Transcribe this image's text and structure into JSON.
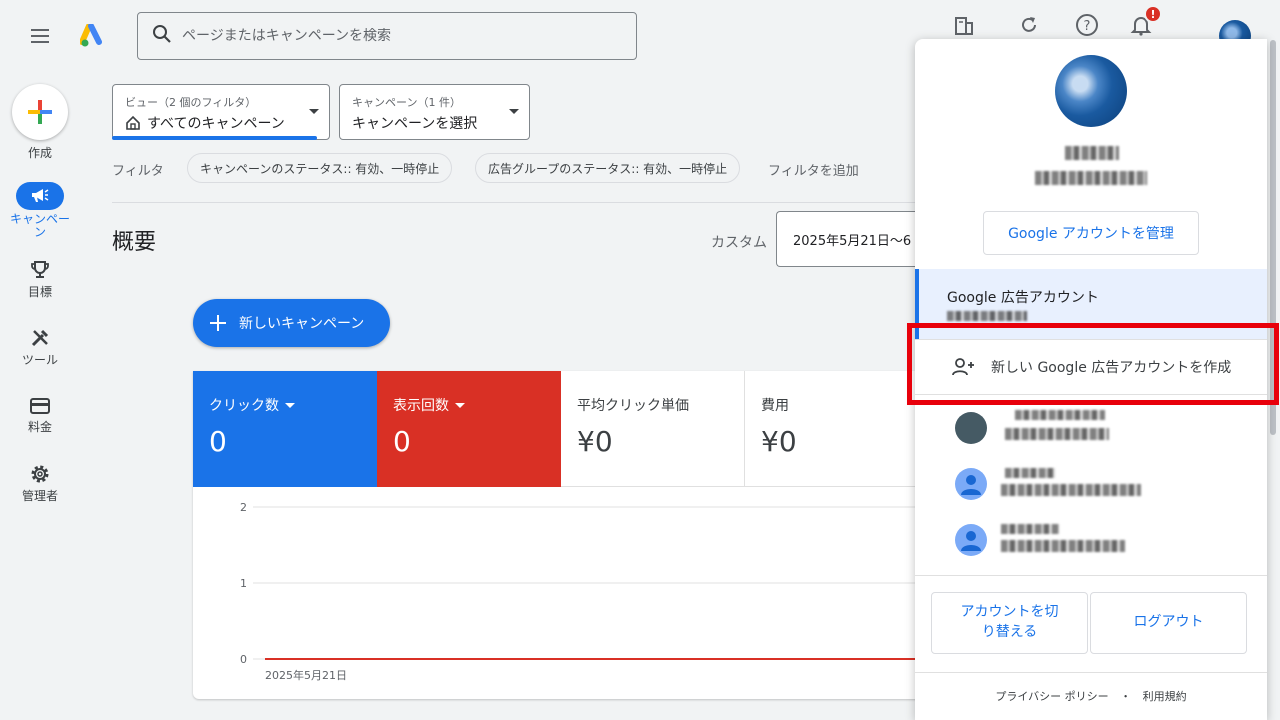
{
  "topbar": {
    "search_placeholder": "ページまたはキャンペーンを検索",
    "notification_count": "!"
  },
  "nav": {
    "create": "作成",
    "campaigns": "キャンペー\nン",
    "goals": "目標",
    "tools": "ツール",
    "billing": "料金",
    "admin": "管理者"
  },
  "filters": {
    "view_small": "ビュー（2 個のフィルタ）",
    "view_big": "すべてのキャンペーン",
    "campaign_small": "キャンペーン（1 件）",
    "campaign_big": "キャンペーンを選択",
    "filter_label": "フィルタ",
    "chip1": "キャンペーンのステータス:: 有効、一時停止",
    "chip2": "広告グループのステータス:: 有効、一時停止",
    "add_filter": "フィルタを追加"
  },
  "overview": {
    "title": "概要",
    "range_label": "カスタム",
    "date": "2025年5月21日〜6",
    "new_campaign": "新しいキャンペーン"
  },
  "metrics": [
    {
      "label": "クリック数",
      "value": "0",
      "color": "#1a73e8"
    },
    {
      "label": "表示回数",
      "value": "0",
      "color": "#d93025"
    },
    {
      "label": "平均クリック単価",
      "value": "¥0"
    },
    {
      "label": "費用",
      "value": "¥0"
    }
  ],
  "chart_data": {
    "type": "line",
    "x": [
      "2025年5月21日"
    ],
    "series": [
      {
        "values": [
          0
        ],
        "color": "#d93025"
      }
    ],
    "yticks": [
      "2",
      "1",
      "0"
    ],
    "ylim": [
      0,
      2
    ]
  },
  "popup": {
    "manage": "Google アカウントを管理",
    "account_title": "Google 広告アカウント",
    "create_account": "新しい Google 広告アカウントを作成",
    "switch": "アカウントを切り替える",
    "logout": "ログアウト",
    "privacy": "プライバシー ポリシー",
    "dot": "・",
    "terms": "利用規約"
  }
}
